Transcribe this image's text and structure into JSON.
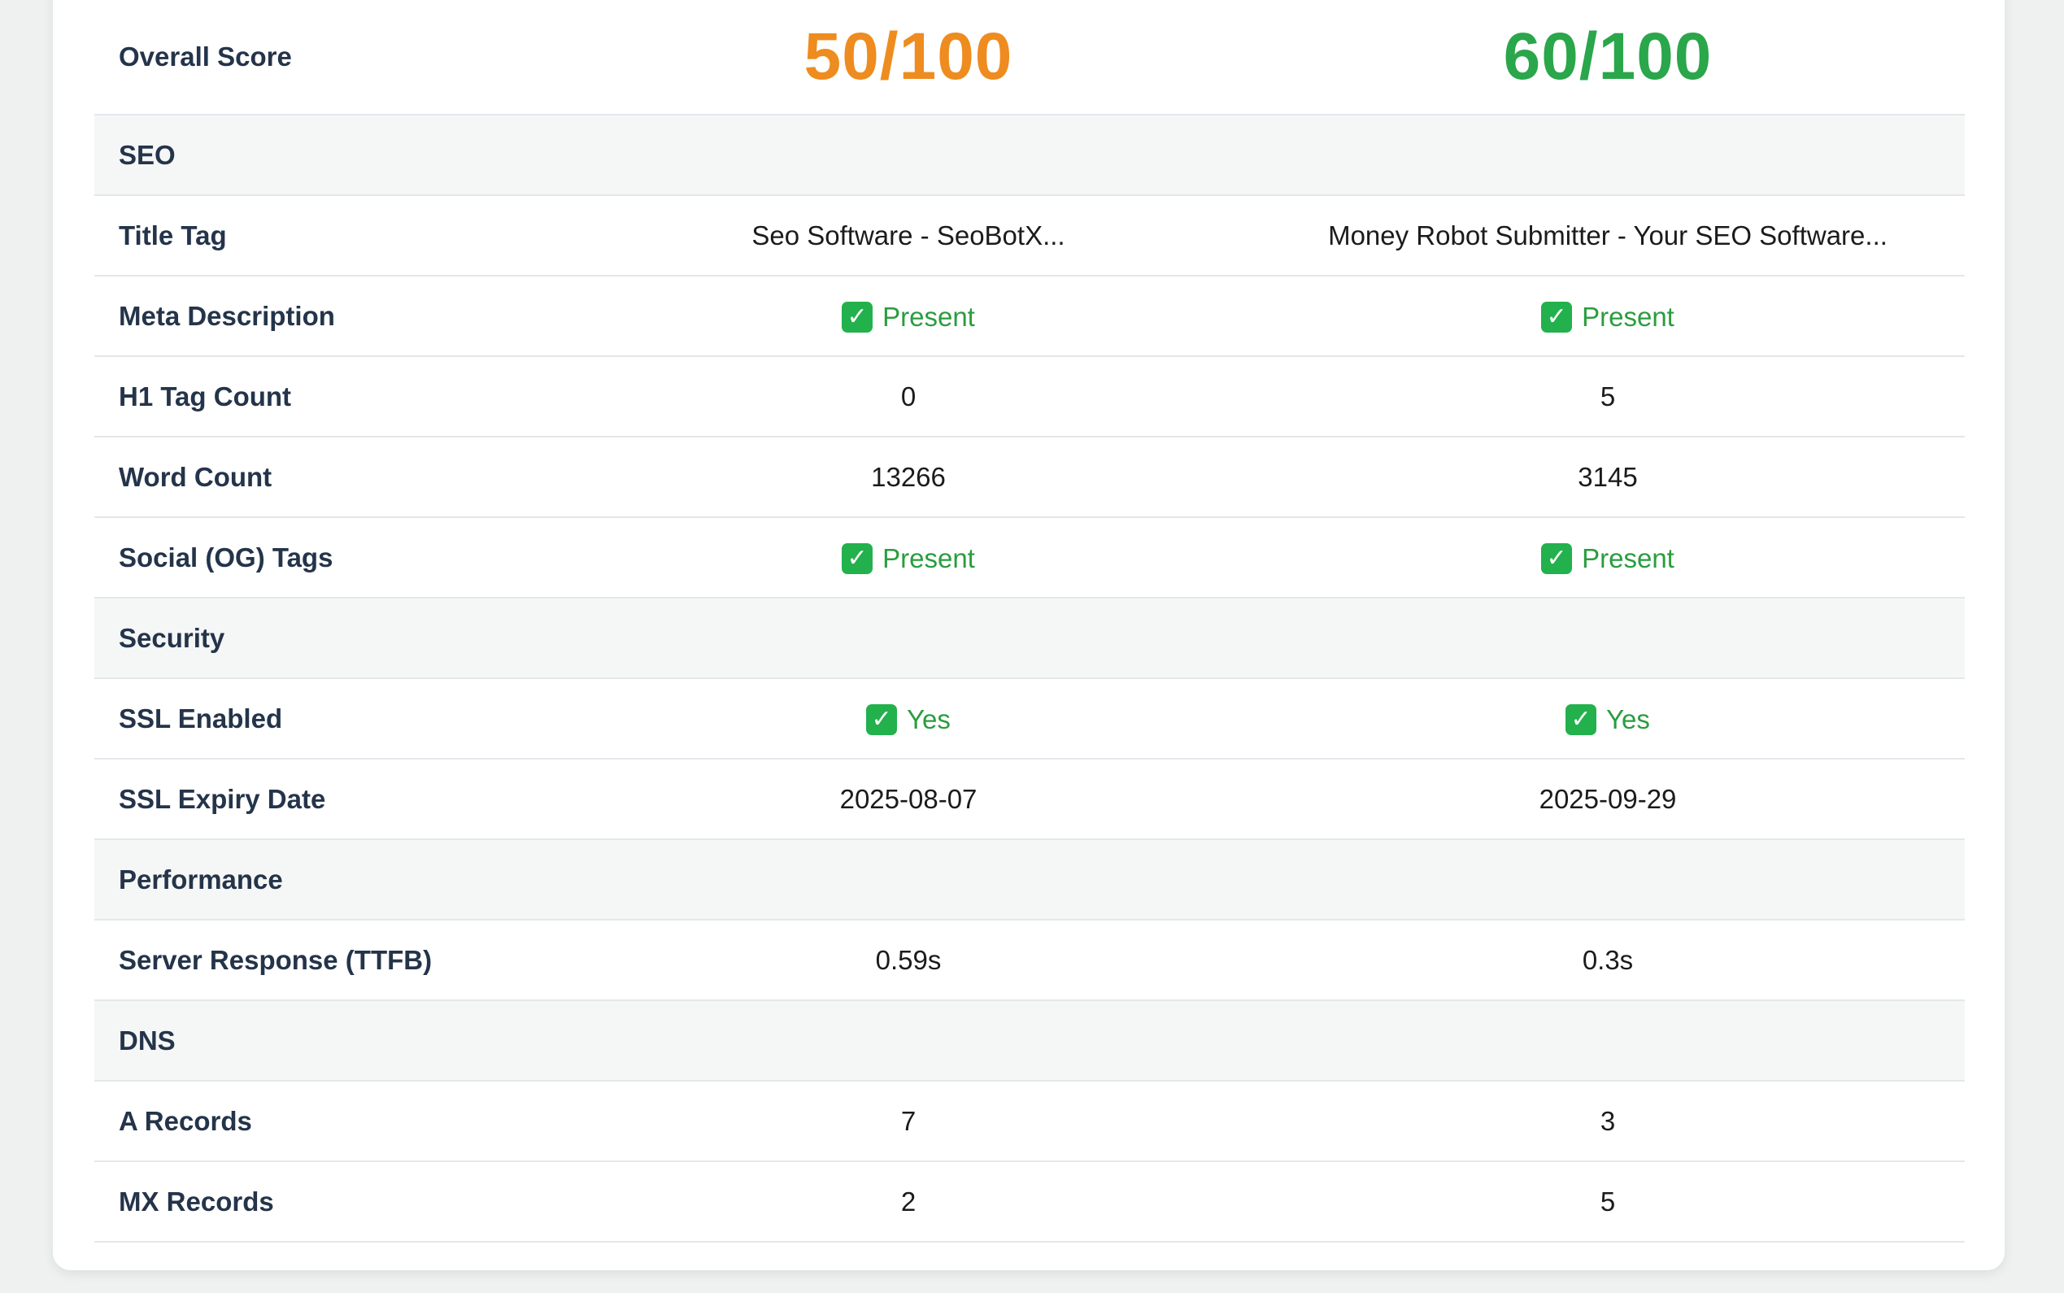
{
  "colors": {
    "score_a": "#ee8c1f",
    "score_b": "#2aa64b",
    "status_ok": "#2a9d3f"
  },
  "score": {
    "label": "Overall Score",
    "site_a": "50/100",
    "site_b": "60/100"
  },
  "sections": {
    "seo": "SEO",
    "security": "Security",
    "performance": "Performance",
    "dns": "DNS"
  },
  "rows": {
    "title_tag": {
      "label": "Title Tag",
      "a": "Seo Software - SeoBotX...",
      "b": "Money Robot Submitter - Your SEO Software..."
    },
    "meta_description": {
      "label": "Meta Description",
      "a": "Present",
      "b": "Present",
      "icon": "check-mark-icon"
    },
    "h1_count": {
      "label": "H1 Tag Count",
      "a": "0",
      "b": "5"
    },
    "word_count": {
      "label": "Word Count",
      "a": "13266",
      "b": "3145"
    },
    "og_tags": {
      "label": "Social (OG) Tags",
      "a": "Present",
      "b": "Present",
      "icon": "check-mark-icon"
    },
    "ssl_enabled": {
      "label": "SSL Enabled",
      "a": "Yes",
      "b": "Yes",
      "icon": "check-mark-icon"
    },
    "ssl_expiry": {
      "label": "SSL Expiry Date",
      "a": "2025-08-07",
      "b": "2025-09-29"
    },
    "ttfb": {
      "label": "Server Response (TTFB)",
      "a": "0.59s",
      "b": "0.3s"
    },
    "a_records": {
      "label": "A Records",
      "a": "7",
      "b": "3"
    },
    "mx_records": {
      "label": "MX Records",
      "a": "2",
      "b": "5"
    }
  }
}
